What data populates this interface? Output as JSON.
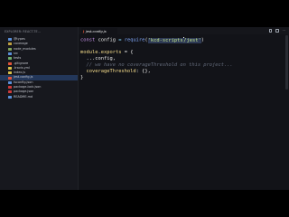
{
  "sidebar": {
    "header": "EXPLORER: REACT-TE...",
    "items": [
      {
        "label": "@types",
        "icon": "folder-icon",
        "color": "#5b8fd9"
      },
      {
        "label": "coverage",
        "icon": "folder-icon",
        "color": "#c0a040"
      },
      {
        "label": "node_modules",
        "icon": "folder-icon",
        "color": "#7fa35a"
      },
      {
        "label": "src",
        "icon": "folder-icon",
        "color": "#5b8fd9"
      },
      {
        "label": "tests",
        "icon": "folder-icon",
        "color": "#6fae6a"
      },
      {
        "label": ".gitignore",
        "icon": "git-icon",
        "color": "#e2543a"
      },
      {
        "label": ".travis.yml",
        "icon": "yaml-icon",
        "color": "#d6c04a"
      },
      {
        "label": "index.js",
        "icon": "js-icon",
        "color": "#d6c04a"
      },
      {
        "label": "jest.config.js",
        "icon": "jest-icon",
        "color": "#e2543a"
      },
      {
        "label": "tsconfig.json",
        "icon": "json-icon",
        "color": "#5b8fd9"
      },
      {
        "label": "package-lock.json",
        "icon": "npm-icon",
        "color": "#cc3a3a"
      },
      {
        "label": "package.json",
        "icon": "npm-icon",
        "color": "#cc3a3a"
      },
      {
        "label": "README.md",
        "icon": "info-icon",
        "color": "#5b8fd9"
      }
    ],
    "selected_index": 8
  },
  "editor": {
    "tab_label": "jest.config.js",
    "tab_icon": "jest-icon",
    "code": {
      "l1_kw": "const",
      "l1_name": " config ",
      "l1_eq": "= ",
      "l1_fn": "require",
      "l1_open": "(",
      "l1_str_a": "'kcd-scripts",
      "l1_str_b": "/jest'",
      "l1_close": ")",
      "l3_obj": "module",
      "l3_dot": ".",
      "l3_prop": "exports",
      "l3_rest": " = {",
      "l4_text": "  ...config,",
      "l5_comment": "  // we have no coverageThreshold on this project...",
      "l6_prop": "  coverageThreshold",
      "l6_rest": ": {},",
      "l7_text": "}"
    }
  }
}
